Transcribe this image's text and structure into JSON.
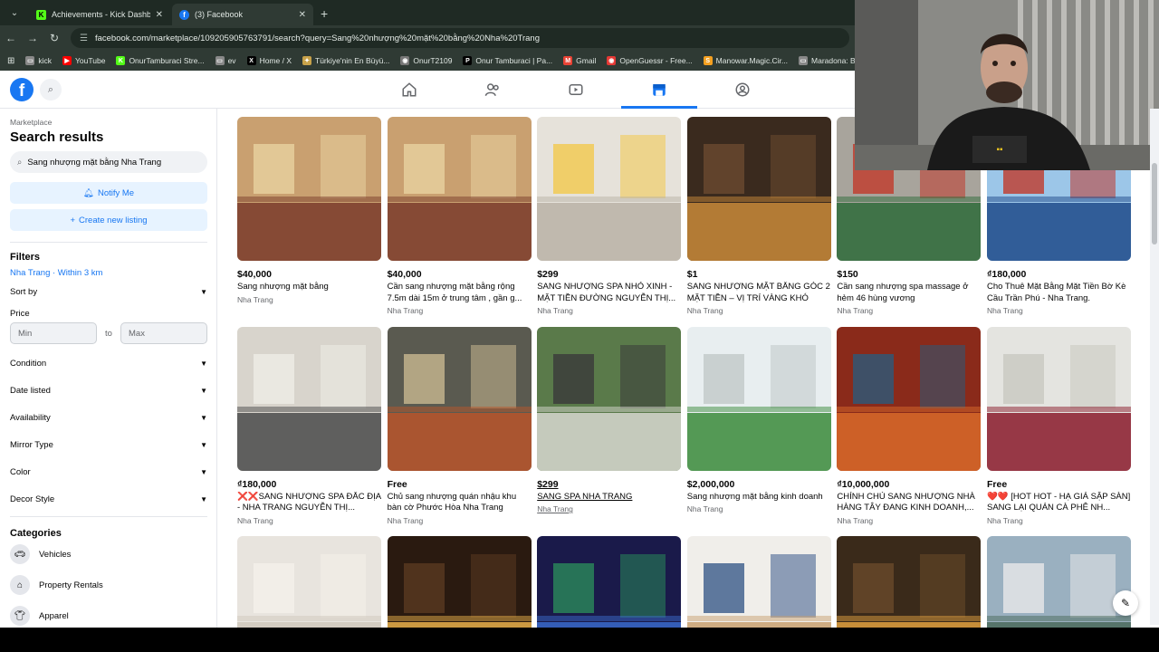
{
  "browser": {
    "tabs": [
      {
        "title": "Achievements - Kick Dashboard",
        "icon": "kick-icon",
        "color": "#53fc18",
        "glyph": "K"
      },
      {
        "title": "(3) Facebook",
        "icon": "facebook-icon",
        "color": "#1877f2",
        "glyph": "f"
      }
    ],
    "url": "facebook.com/marketplace/109205905763791/search?query=Sang%20nhượng%20mặt%20bằng%20Nha%20Trang",
    "bookmarks": [
      {
        "label": "kick",
        "color": "#888888",
        "glyph": "▭"
      },
      {
        "label": "YouTube",
        "color": "#ff0000",
        "glyph": "▶"
      },
      {
        "label": "OnurTamburaci Stre...",
        "color": "#53fc18",
        "glyph": "K"
      },
      {
        "label": "ev",
        "color": "#888888",
        "glyph": "▭"
      },
      {
        "label": "Home / X",
        "color": "#000000",
        "glyph": "X"
      },
      {
        "label": "Türkiye'nin En Büyü...",
        "color": "#c8a24a",
        "glyph": "✦"
      },
      {
        "label": "OnurT2109",
        "color": "#777777",
        "glyph": "◉"
      },
      {
        "label": "Onur Tamburaci | Pa...",
        "color": "#000000",
        "glyph": "P"
      },
      {
        "label": "Gmail",
        "color": "#ea4335",
        "glyph": "M"
      },
      {
        "label": "OpenGuessr - Free...",
        "color": "#e53935",
        "glyph": "◉"
      },
      {
        "label": "Manowar.Magic.Cir...",
        "color": "#f4a020",
        "glyph": "S"
      },
      {
        "label": "Maradona: Blessed...",
        "color": "#888888",
        "glyph": "▭"
      }
    ]
  },
  "sidebar": {
    "breadcrumb": "Marketplace",
    "title": "Search results",
    "search_value": "Sang nhượng mặt bằng Nha Trang",
    "notify_label": "Notify Me",
    "create_label": "Create new listing",
    "filters_title": "Filters",
    "location": "Nha Trang · Within 3 km",
    "sort_by": "Sort by",
    "price_label": "Price",
    "price_min_placeholder": "Min",
    "price_to": "to",
    "price_max_placeholder": "Max",
    "filters": [
      "Condition",
      "Date listed",
      "Availability",
      "Mirror Type",
      "Color",
      "Decor Style"
    ],
    "categories_title": "Categories",
    "categories": [
      {
        "label": "Vehicles",
        "icon": "car-icon"
      },
      {
        "label": "Property Rentals",
        "icon": "house-icon"
      },
      {
        "label": "Apparel",
        "icon": "shirt-icon"
      }
    ]
  },
  "listings": [
    {
      "price": "$40,000",
      "title": "Sang nhượng mặt bằng",
      "location": "Nha Trang",
      "colors": [
        "#c9a070",
        "#7a3b2a",
        "#e8d2a0"
      ]
    },
    {
      "price": "$40,000",
      "title": "Cần sang nhượng mặt bằng rộng 7.5m dài 15m ở trung tâm , gần g...",
      "location": "Nha Trang",
      "colors": [
        "#c9a070",
        "#7a3b2a",
        "#e8d2a0"
      ]
    },
    {
      "price": "$299",
      "title": "SANG NHƯỢNG SPA NHỎ XINH - MẶT TIỀN ĐƯỜNG NGUYỄN THỊ...",
      "location": "Nha Trang",
      "colors": [
        "#e6e2da",
        "#b8b2a6",
        "#f2c94c"
      ]
    },
    {
      "price": "$1",
      "title": "SANG NHƯỢNG MẶT BẰNG GÓC 2 MẶT TIỀN – VỊ TRÍ VÀNG KHÓ TÌM...",
      "location": "Nha Trang",
      "colors": [
        "#3a2a1e",
        "#c98a3a",
        "#6b4a30"
      ]
    },
    {
      "price": "$150",
      "title": "Cần sang nhượng spa massage ở hẻm 46 hùng vương",
      "location": "Nha Trang",
      "colors": [
        "#a8a49c",
        "#2e6b3a",
        "#c0392b"
      ]
    },
    {
      "price": "₫180,000",
      "title": "Cho Thuê Mặt Bằng Mặt Tiền Bờ Kè Cầu Trần Phú - Nha Trang.",
      "location": "Nha Trang",
      "colors": [
        "#9cc6e8",
        "#1f4a8a",
        "#c0392b"
      ]
    },
    {
      "price": "₫180,000",
      "title": "❌❌SANG NHƯỢNG SPA ĐẮC ĐỊA - NHA TRANG NGUYỄN THỊ...",
      "location": "Nha Trang",
      "colors": [
        "#d8d4cc",
        "#4a4a4a",
        "#efece6"
      ]
    },
    {
      "price": "Free",
      "title": "Chủ sang nhượng quán nhậu khu bàn cờ Phước Hòa Nha Trang",
      "location": "Nha Trang",
      "colors": [
        "#5a5a50",
        "#b8552a",
        "#c8b890"
      ]
    },
    {
      "price": "$299",
      "title": "SANG SPA NHA TRANG",
      "location": "Nha Trang",
      "colors": [
        "#5a7a4a",
        "#d8d8d0",
        "#3a3a3a"
      ]
    },
    {
      "price": "$2,000,000",
      "title": "Sang nhượng mặt bằng kinh doanh",
      "location": "Nha Trang",
      "colors": [
        "#e8eef0",
        "#3a8a3a",
        "#c0c8c8"
      ]
    },
    {
      "price": "₫10,000,000",
      "title": "CHÍNH CHỦ SANG NHƯỢNG NHÀ HÀNG TÂY ĐANG KINH DOANH,...",
      "location": "Nha Trang",
      "colors": [
        "#8a2a1a",
        "#d86a2a",
        "#2a5a7a"
      ]
    },
    {
      "price": "Free",
      "title": "❤️❤️ [HOT HOT - HẠ GIÁ SẬP SÀN] SANG LẠI QUÁN CÀ PHÊ NH...",
      "location": "Nha Trang",
      "colors": [
        "#e4e4e0",
        "#8a1a2a",
        "#c8c8c0"
      ]
    },
    {
      "price": "",
      "title": "",
      "location": "",
      "colors": [
        "#e8e4de",
        "#cfc8bc",
        "#f4f0ea"
      ]
    },
    {
      "price": "",
      "title": "",
      "location": "",
      "colors": [
        "#2a1a10",
        "#e8b04a",
        "#5a3a20"
      ]
    },
    {
      "price": "",
      "title": "",
      "location": "",
      "colors": [
        "#1a1a4a",
        "#3a6aca",
        "#2a8a5a"
      ]
    },
    {
      "price": "",
      "title": "",
      "location": "",
      "colors": [
        "#f0eeea",
        "#c8a070",
        "#3a5a8a"
      ]
    },
    {
      "price": "",
      "title": "",
      "location": "",
      "colors": [
        "#3a2a1a",
        "#e0a040",
        "#6a4a2a"
      ]
    },
    {
      "price": "",
      "title": "",
      "location": "",
      "colors": [
        "#9ab0c0",
        "#4a6a5a",
        "#e8e8e8"
      ]
    }
  ]
}
